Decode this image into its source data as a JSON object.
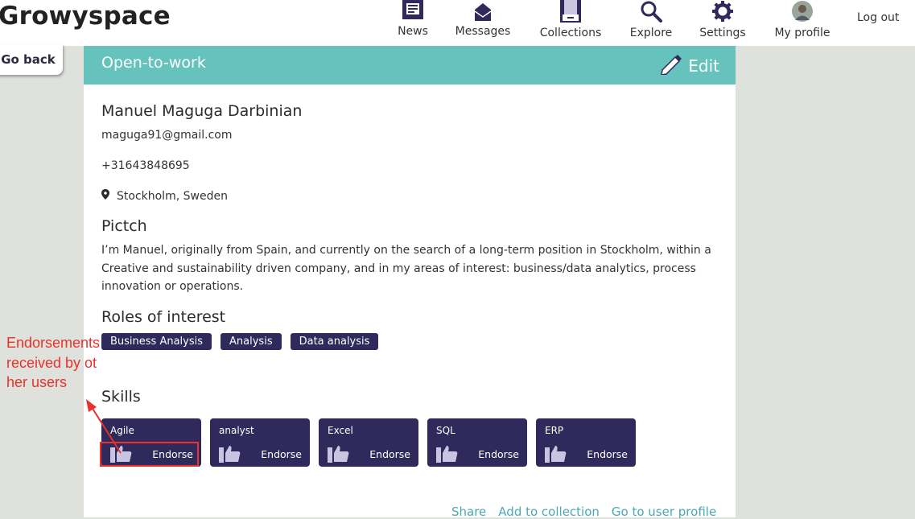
{
  "app": {
    "brand": "Growyspace"
  },
  "nav": {
    "items": [
      {
        "label": "News",
        "icon": "newspaper-icon"
      },
      {
        "label": "Messages",
        "icon": "envelope-icon"
      },
      {
        "label": "Collections",
        "icon": "file-cabinet-icon"
      },
      {
        "label": "Explore",
        "icon": "search-icon"
      },
      {
        "label": "Settings",
        "icon": "gear-icon"
      },
      {
        "label": "My profile",
        "icon": "avatar-photo"
      }
    ],
    "logout": "Log out"
  },
  "go_back": "Go back",
  "card": {
    "title": "Open-to-work",
    "edit_label": "Edit",
    "name": "Manuel Maguga Darbinian",
    "email": "maguga91@gmail.com",
    "phone": "+31643848695",
    "location": "Stockholm, Sweden",
    "pitch_heading": "Pictch",
    "pitch": "I’m Manuel, originally from Spain, and currently on the search of a long-term position in Stockholm, within a Creative and sustainability driven company, and in my areas of interest: business/data analytics, process innovation or operations.",
    "roles_heading": "Roles of interest",
    "roles": [
      "Business Analysis",
      "Analysis",
      "Data analysis"
    ],
    "skills_heading": "Skills",
    "skills": [
      {
        "name": "Agile",
        "action": "Endorse"
      },
      {
        "name": "analyst",
        "action": "Endorse"
      },
      {
        "name": "Excel",
        "action": "Endorse"
      },
      {
        "name": "SQL",
        "action": "Endorse"
      },
      {
        "name": "ERP",
        "action": "Endorse"
      }
    ],
    "footer_links": [
      "Share",
      "Add to collection",
      "Go to user profile"
    ]
  },
  "annotation": {
    "text": "Endorsements received by other users",
    "color": "#e8322a"
  },
  "colors": {
    "header": "#66c2bd",
    "tag": "#2f2a5b",
    "link": "#4aa9b3"
  }
}
